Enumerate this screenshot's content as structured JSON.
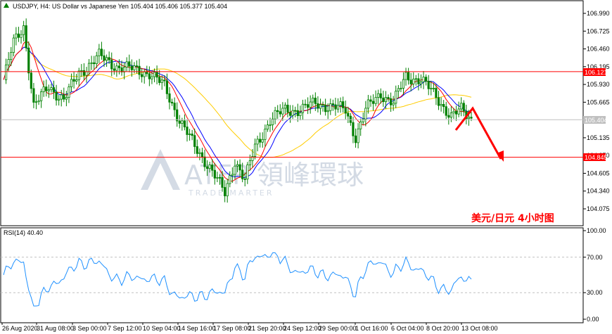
{
  "header": {
    "symbol_line": "USDJPY, H4:  US Dollar vs Japanese Yen  105.404 105.406 105.377 105.404"
  },
  "main_price_axis": {
    "ticks": [
      "106.990",
      "106.725",
      "106.460",
      "106.195",
      "105.930",
      "105.665",
      "105.135",
      "104.870",
      "104.605",
      "104.340",
      "104.075"
    ]
  },
  "price_tags": {
    "resistance": "106.121",
    "current": "105.404",
    "support": "104.845"
  },
  "levels": {
    "resistance": 106.121,
    "current": 105.404,
    "support": 104.845
  },
  "chart_annotation": "美元/日元  4小时图",
  "watermark": {
    "brand": "ATFP 領峰環球",
    "sub": "TRADE MARTER"
  },
  "rsi": {
    "label": "RSI(14) 40.40",
    "ticks": [
      "100.00",
      "70.00",
      "30.00",
      "0.00"
    ]
  },
  "time_axis": [
    "26 Aug 2020",
    "31 Aug 08:00",
    "3 Sep 00:00",
    "7 Sep 12:00",
    "10 Sep 04:00",
    "14 Sep 16:00",
    "17 Sep 08:00",
    "21 Sep 20:00",
    "24 Sep 12:00",
    "29 Sep 00:00",
    "1 Oct 16:00",
    "6 Oct 04:00",
    "8 Oct 20:00",
    "13 Oct 08:00"
  ],
  "colors": {
    "bull": "#ffffff",
    "bear": "#000000",
    "candle_body": "#008000",
    "ma_fast": "#ff0000",
    "ma_mid": "#0000ff",
    "ma_slow": "#ffcc00",
    "level_line": "#ff0000",
    "rsi_line": "#1e90ff",
    "annotation": "#ff0000"
  }
}
